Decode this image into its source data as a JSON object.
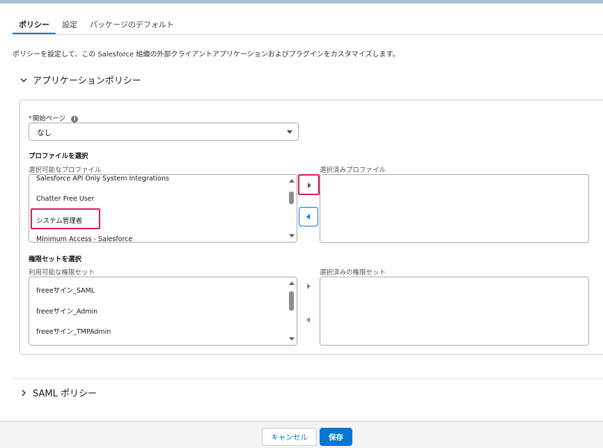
{
  "tabs": [
    {
      "label": "ポリシー",
      "active": true
    },
    {
      "label": "設定",
      "active": false
    },
    {
      "label": "パッケージのデフォルト",
      "active": false
    }
  ],
  "description": "ポリシーを設定して、この Salesforce 組織の外部クライアントアプリケーションおよびプラグインをカスタマイズします。",
  "app_policy_section": {
    "title": "アプリケーションポリシー",
    "expanded": true
  },
  "start_page": {
    "required_marker": "*",
    "label": "開始ページ",
    "info_icon": "i",
    "value": "なし"
  },
  "profiles": {
    "heading": "プロファイルを選択",
    "available_label": "選択可能なプロファイル",
    "selected_label": "選択済みプロファイル",
    "available": [
      "Salesforce API Only System Integrations",
      "Chatter Free User",
      "システム管理者",
      "Minimum Access - Salesforce"
    ],
    "selected": []
  },
  "permission_sets": {
    "heading": "権限セットを選択",
    "available_label": "利用可能な権限セット",
    "selected_label": "選択済みの権限セット",
    "available": [
      "freeeサイン_SAML",
      "freeeサイン_Admin",
      "freeeサイン_TMPAdmin"
    ],
    "selected": []
  },
  "saml_policy_section": {
    "title": "SAML ポリシー",
    "expanded": false
  },
  "footer": {
    "cancel_label": "キャンセル",
    "save_label": "保存"
  },
  "colors": {
    "brand": "#0176d3",
    "highlight": "#e3145e",
    "required": "#ba0517"
  },
  "icons": {
    "chevron_down": "chevron-down-icon",
    "chevron_right": "chevron-right-icon",
    "move_right": "move-right-icon",
    "move_left": "move-left-icon",
    "info": "info-icon"
  }
}
